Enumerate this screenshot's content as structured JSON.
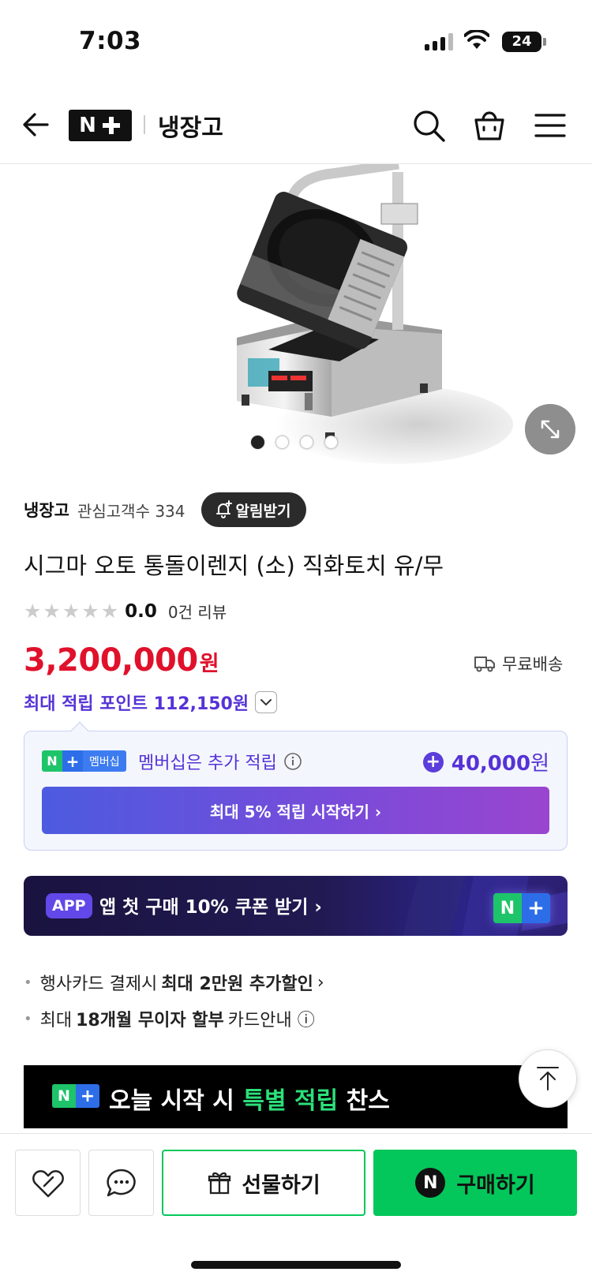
{
  "status_bar": {
    "time": "7:03",
    "battery": "24"
  },
  "header": {
    "logo_n": "N",
    "category": "냉장고"
  },
  "gallery": {
    "slide_count": 4,
    "active_slide": 0
  },
  "product": {
    "store": "냉장고",
    "fans_label": "관심고객수 334",
    "alarm_label": "알림받기",
    "title": "시그마 오토 통돌이렌지 (소) 직화토치 유/무",
    "rating": "0.0",
    "review_count": "0건 리뷰",
    "price": "3,200,000",
    "price_unit": "원",
    "shipping": "무료배송",
    "max_points": "최대 적립 포인트 112,150원"
  },
  "membership": {
    "badge_text": "멤버십",
    "message": "멤버십은 추가 적립",
    "bonus": "40,000",
    "bonus_unit": "원",
    "cta": "최대 5% 적립 시작하기 ›"
  },
  "app_banner": {
    "tag": "APP",
    "text": "앱 첫 구매 10% 쿠폰 받기 ›"
  },
  "benefits": [
    {
      "pre": "행사카드 결제시",
      "bold": "최대 2만원 추가할인",
      "post": "›"
    },
    {
      "pre": "최대",
      "bold": "18개월 무이자 할부",
      "post": "카드안내 ⓘ"
    }
  ],
  "nplus_banner": {
    "text_pre": "오늘 시작 시 ",
    "text_hl": "특별 적립",
    "text_post": " 찬스"
  },
  "bottom_bar": {
    "gift_label": "선물하기",
    "buy_label": "구매하기",
    "buy_n": "N"
  },
  "colors": {
    "price": "#e0112b",
    "points": "#5533d6",
    "naver_green": "#03c75a",
    "naver_blue": "#2d6ee8"
  }
}
